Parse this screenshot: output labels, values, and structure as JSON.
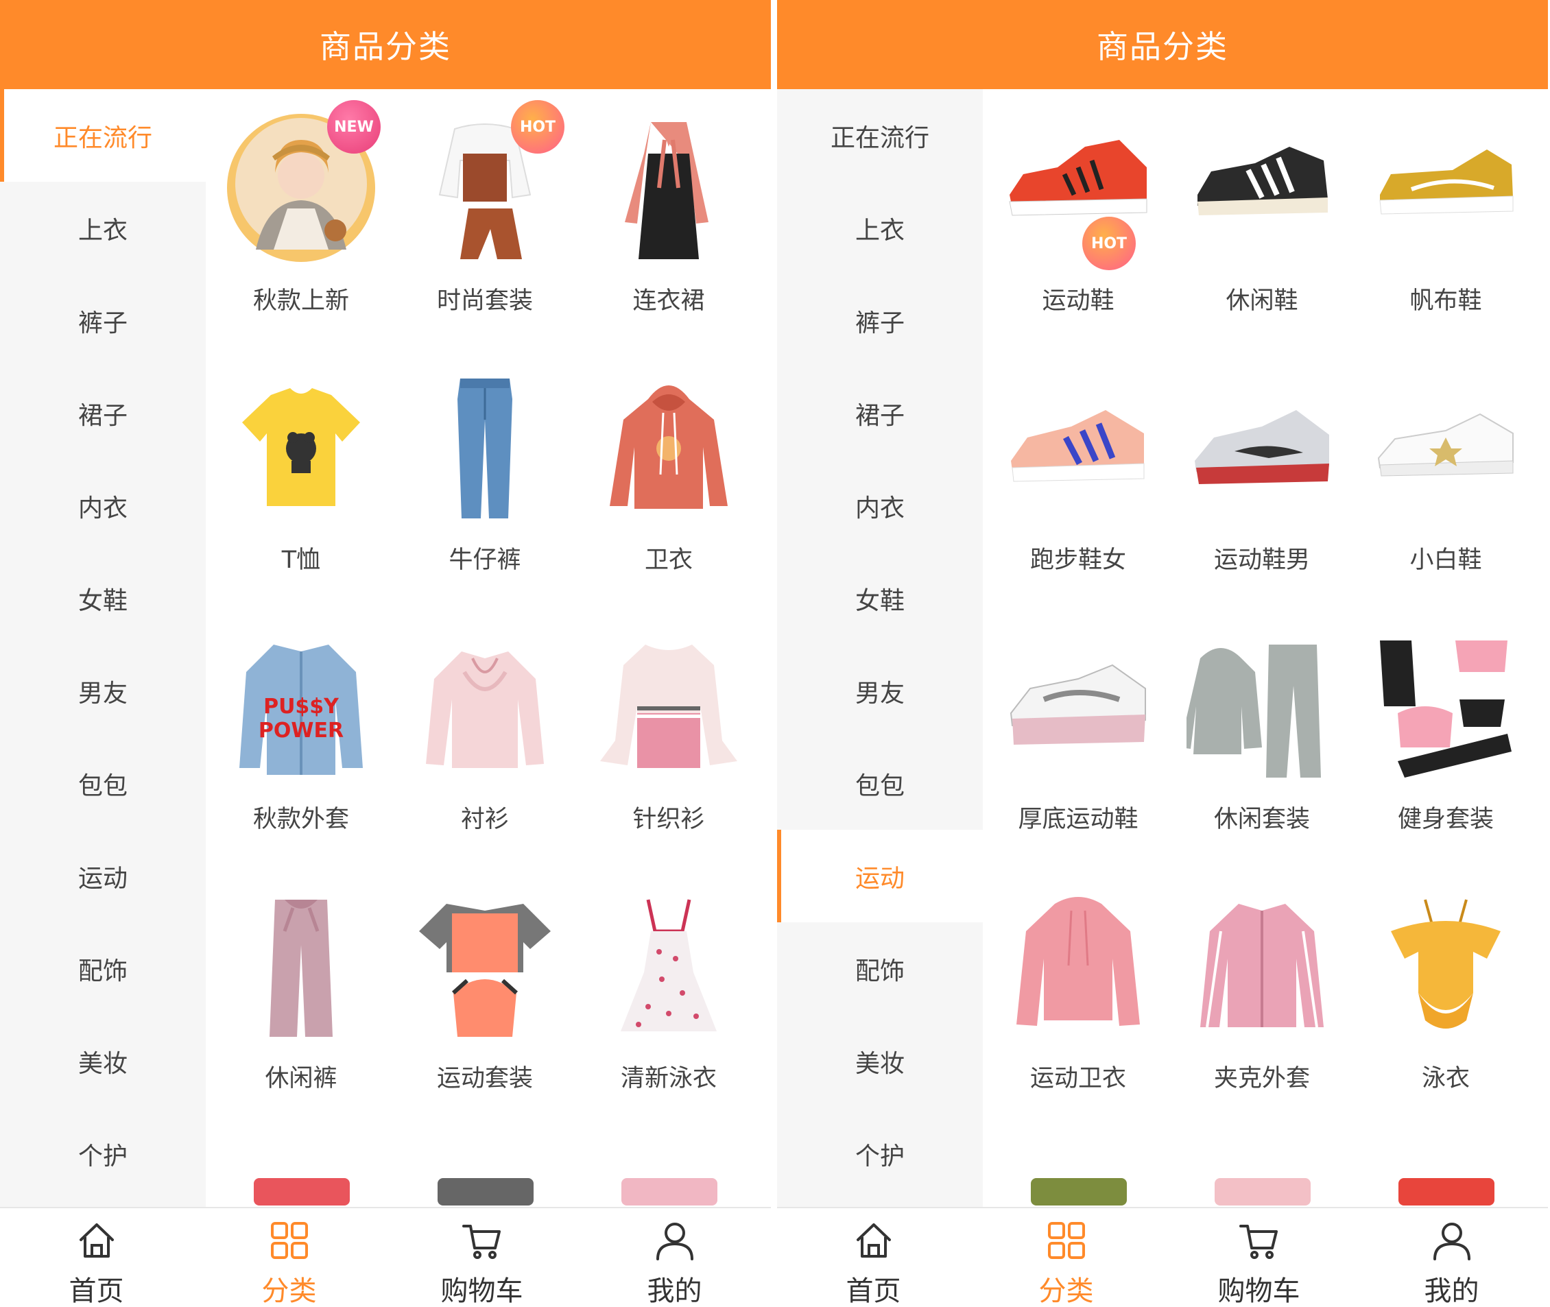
{
  "colors": {
    "accent": "#FF8A2A",
    "sidebar_bg": "#f6f6f6",
    "text": "#444444"
  },
  "screens": [
    {
      "title": "商品分类",
      "active_category_index": 0,
      "categories": [
        "正在流行",
        "上衣",
        "裤子",
        "裙子",
        "内衣",
        "女鞋",
        "男友",
        "包包",
        "运动",
        "配饰",
        "美妆",
        "个护"
      ],
      "items": [
        {
          "label": "秋款上新",
          "icon": "girl-portrait-icon",
          "badge": "NEW"
        },
        {
          "label": "时尚套装",
          "icon": "outfit-set-icon",
          "badge": "HOT"
        },
        {
          "label": "连衣裙",
          "icon": "dress-icon"
        },
        {
          "label": "T恤",
          "icon": "tshirt-icon"
        },
        {
          "label": "牛仔裤",
          "icon": "jeans-icon"
        },
        {
          "label": "卫衣",
          "icon": "hoodie-icon"
        },
        {
          "label": "秋款外套",
          "icon": "denim-jacket-icon"
        },
        {
          "label": "衬衫",
          "icon": "blouse-icon"
        },
        {
          "label": "针织衫",
          "icon": "knit-sweater-icon"
        },
        {
          "label": "休闲裤",
          "icon": "wide-pants-icon"
        },
        {
          "label": "运动套装",
          "icon": "sport-set-icon"
        },
        {
          "label": "清新泳衣",
          "icon": "swimsuit-dress-icon"
        }
      ]
    },
    {
      "title": "商品分类",
      "active_category_index": 8,
      "categories": [
        "正在流行",
        "上衣",
        "裤子",
        "裙子",
        "内衣",
        "女鞋",
        "男友",
        "包包",
        "运动",
        "配饰",
        "美妆",
        "个护"
      ],
      "items": [
        {
          "label": "运动鞋",
          "icon": "sneaker-icon",
          "badge": "HOT"
        },
        {
          "label": "休闲鞋",
          "icon": "casual-shoe-icon"
        },
        {
          "label": "帆布鞋",
          "icon": "canvas-shoe-icon"
        },
        {
          "label": "跑步鞋女",
          "icon": "running-shoe-icon"
        },
        {
          "label": "运动鞋男",
          "icon": "mens-sneaker-icon"
        },
        {
          "label": "小白鞋",
          "icon": "white-shoe-icon"
        },
        {
          "label": "厚底运动鞋",
          "icon": "chunky-sneaker-icon"
        },
        {
          "label": "休闲套装",
          "icon": "tracksuit-icon"
        },
        {
          "label": "健身套装",
          "icon": "fitness-set-icon"
        },
        {
          "label": "运动卫衣",
          "icon": "sweatshirt-icon"
        },
        {
          "label": "夹克外套",
          "icon": "jacket-icon"
        },
        {
          "label": "泳衣",
          "icon": "swimsuit-icon"
        }
      ]
    }
  ],
  "tabbar": [
    {
      "label": "首页",
      "icon": "home-icon"
    },
    {
      "label": "分类",
      "icon": "category-grid-icon"
    },
    {
      "label": "购物车",
      "icon": "cart-icon"
    },
    {
      "label": "我的",
      "icon": "user-icon"
    }
  ],
  "active_tab_index": 1
}
